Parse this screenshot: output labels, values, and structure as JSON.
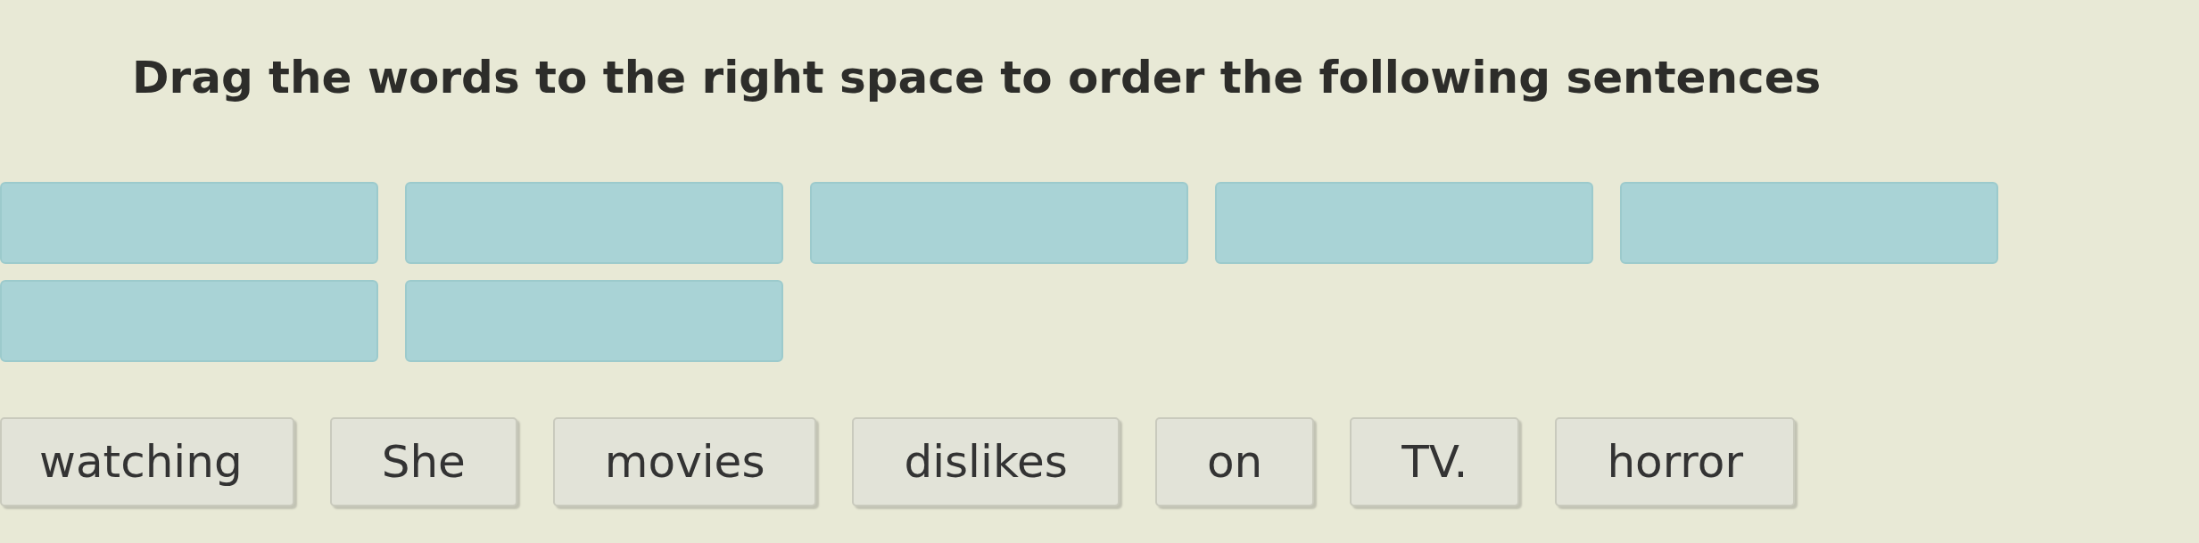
{
  "title": "Drag the words to the right space to order the following sentences",
  "answer_rows": [
    {
      "slots": [
        {
          "empty": true
        },
        {
          "empty": true
        },
        {
          "empty": true
        },
        {
          "empty": true
        },
        {
          "empty": true
        }
      ]
    },
    {
      "slots": [
        {
          "empty": true
        },
        {
          "empty": true
        }
      ]
    }
  ],
  "words": [
    "watching",
    "She",
    "movies",
    "dislikes",
    "on",
    "TV.",
    "horror"
  ]
}
